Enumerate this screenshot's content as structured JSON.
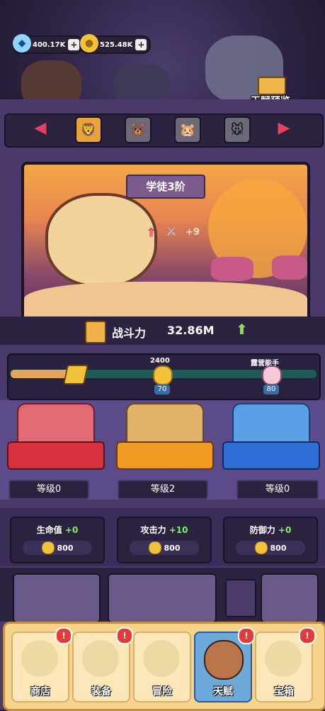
{
  "resources": {
    "gems": "400.17K",
    "coins": "525.48K"
  },
  "talent_preview": "天赋预览",
  "stage": {
    "rank": "学徒3阶",
    "bonus": "+9"
  },
  "power": {
    "label": "战斗力",
    "value": "32.86M"
  },
  "progress": {
    "milestone_value": "2400",
    "milestone_level": "70",
    "next_label": "露营能手",
    "next_level": "80"
  },
  "cards": [
    {
      "level": "等级0"
    },
    {
      "level": "等级2"
    },
    {
      "level": "等级0"
    }
  ],
  "stats": [
    {
      "label": "生命值",
      "bonus": "+0",
      "cost": "800"
    },
    {
      "label": "攻击力",
      "bonus": "+10",
      "cost": "800"
    },
    {
      "label": "防御力",
      "bonus": "+0",
      "cost": "800"
    }
  ],
  "nav": [
    {
      "label": "商店",
      "badge": "!"
    },
    {
      "label": "装备",
      "badge": "!"
    },
    {
      "label": "冒险",
      "badge": ""
    },
    {
      "label": "天赋",
      "badge": "!"
    },
    {
      "label": "宝箱",
      "badge": "!"
    }
  ]
}
